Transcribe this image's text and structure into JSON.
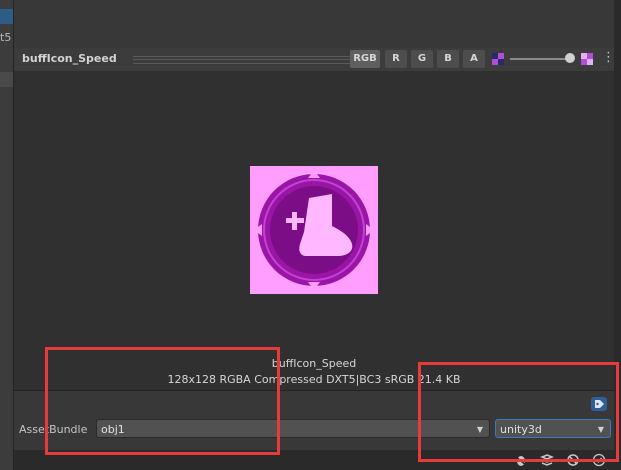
{
  "left_panel": {
    "text": "t5"
  },
  "header": {
    "title": "buffIcon_Speed",
    "channels": [
      "RGB",
      "R",
      "G",
      "B",
      "A"
    ],
    "active_channel": "RGB"
  },
  "preview": {
    "name": "buffIcon_Speed",
    "details": "128x128  RGBA Compressed DXT5|BC3 sRGB   21.4 KB"
  },
  "asset_bundle": {
    "label": "AssetBundle",
    "name_value": "obj1",
    "variant_value": "unity3d"
  },
  "colors": {
    "accent": "#3a79c0",
    "highlight_box": "#e83a3a",
    "icon_bg": "#ff9eff",
    "icon_circle": "#9a15a6"
  },
  "icons": [
    "mipmap-icon",
    "slider",
    "mipmap-icon-2",
    "kebab-menu-icon",
    "tag-icon",
    "bug-icon",
    "layers-icon",
    "no-bug-icon",
    "check-circle-icon"
  ]
}
